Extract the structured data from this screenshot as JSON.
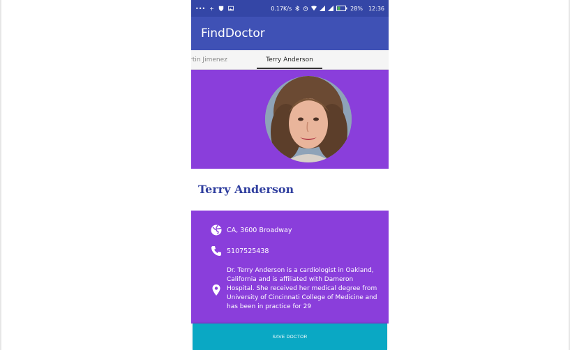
{
  "status_bar": {
    "left_icons": [
      "more-icon",
      "add-icon",
      "shield-icon",
      "image-icon"
    ],
    "speed": "0.17K/s",
    "battery": "28%",
    "time": "12:36"
  },
  "app": {
    "title": "FindDoctor"
  },
  "tabs": [
    {
      "label": "rtin Jimenez",
      "active": false
    },
    {
      "label": "Terry Anderson",
      "active": true
    }
  ],
  "doctor": {
    "name": "Terry Anderson",
    "address": "CA, 3600 Broadway",
    "phone": "5107525438",
    "bio": "Dr. Terry Anderson is a cardiologist in Oakland, California and is affiliated with Dameron Hospital. She received her medical degree from University of Cincinnati College of Medicine and has been in practice for 29"
  },
  "actions": {
    "save_label": "SAVE DOCTOR"
  },
  "colors": {
    "primary": "#3f51b5",
    "status_bar": "#3446a6",
    "purple": "#8a3edb",
    "accent": "#0aa8c4",
    "name_text": "#303f9f"
  }
}
